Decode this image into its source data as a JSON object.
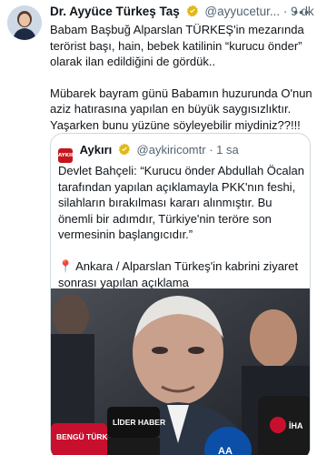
{
  "tweet": {
    "author_name": "Dr. Ayyüce Türkeş Taş",
    "handle": "@ayyucetur...",
    "separator": "·",
    "time": "9 dk",
    "more_icon": "more-icon",
    "paragraph1": "Babam Başbuğ Alparslan TÜRKEŞ'in mezarında terörist başı, hain, bebek katilinin “kurucu önder” olarak ilan edildiğini de gördük..",
    "paragraph2": "Mübarek bayram günü Babamın huzurunda O'nun aziz hatırasına yapılan en büyük saygısızlıktır. Yaşarken bunu yüzüne söyleyebilir miydiniz??!!!"
  },
  "quote": {
    "logo_text": "AYKIRI",
    "author_name": "Aykırı",
    "handle": "@aykiricomtr",
    "separator": "·",
    "time": "1 sa",
    "paragraph1": "Devlet Bahçeli: “Kurucu önder Abdullah Öcalan tarafından yapılan açıklamayla PKK'nın feshi, silahların bırakılması kararı alınmıştır. Bu önemli bir adımdır, Türkiye'nin teröre son vermesinin başlangıcıdır.”",
    "paragraph2": "📍 Ankara / Alparslan Türkeş'in kabrini ziyaret sonrası yapılan açıklama",
    "image": {
      "mic_labels": [
        "BENGÜ TÜRK",
        "LİDER HABER",
        "İHA",
        "AA"
      ]
    }
  },
  "colors": {
    "verified_gold": "#e2b719",
    "secondary_text": "#536471",
    "border": "#cfd9de",
    "aykiri_red": "#c4161c"
  }
}
